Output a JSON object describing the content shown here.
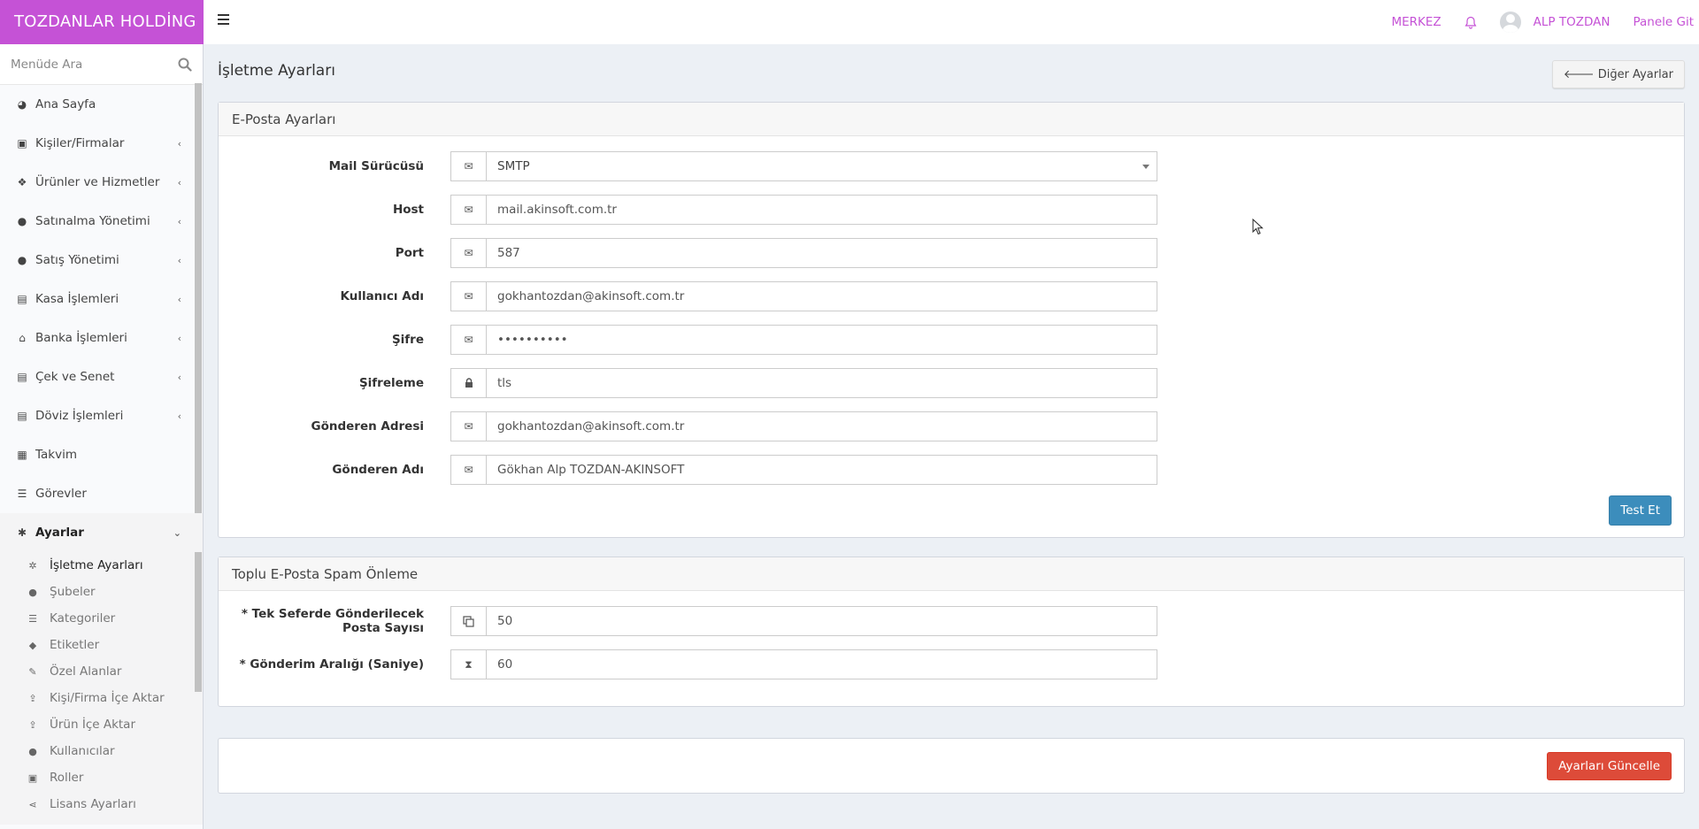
{
  "brand": "TOZDANLAR HOLDİNG",
  "topbar": {
    "branch": "MERKEZ",
    "user_name": "ALP TOZDAN",
    "panel_link": "Panele Git"
  },
  "sidebar": {
    "search_placeholder": "Menüde Ara",
    "items": [
      {
        "label": "Ana Sayfa",
        "icon": "dashboard-icon"
      },
      {
        "label": "Kişiler/Firmalar",
        "icon": "address-book-icon"
      },
      {
        "label": "Ürünler ve Hizmetler",
        "icon": "cubes-icon"
      },
      {
        "label": "Satınalma Yönetimi",
        "icon": "arrow-circle-down-icon"
      },
      {
        "label": "Satış Yönetimi",
        "icon": "arrow-circle-up-icon"
      },
      {
        "label": "Kasa İşlemleri",
        "icon": "money-icon"
      },
      {
        "label": "Banka İşlemleri",
        "icon": "bank-icon"
      },
      {
        "label": "Çek ve Senet",
        "icon": "money-icon"
      },
      {
        "label": "Döviz İşlemleri",
        "icon": "money-icon"
      },
      {
        "label": "Takvim",
        "icon": "calendar-icon"
      },
      {
        "label": "Görevler",
        "icon": "tasks-icon"
      },
      {
        "label": "Ayarlar",
        "icon": "gear-icon"
      }
    ],
    "settings_items": [
      {
        "label": "İşletme Ayarları",
        "icon": "gears-icon"
      },
      {
        "label": "Şubeler",
        "icon": "map-marker-icon"
      },
      {
        "label": "Kategoriler",
        "icon": "list-icon"
      },
      {
        "label": "Etiketler",
        "icon": "tag-icon"
      },
      {
        "label": "Özel Alanlar",
        "icon": "wrench-icon"
      },
      {
        "label": "Kişi/Firma İçe Aktar",
        "icon": "upload-icon"
      },
      {
        "label": "Ürün İçe Aktar",
        "icon": "upload-icon"
      },
      {
        "label": "Kullanıcılar",
        "icon": "user-icon"
      },
      {
        "label": "Roller",
        "icon": "briefcase-icon"
      },
      {
        "label": "Lisans Ayarları",
        "icon": "share-icon"
      }
    ]
  },
  "page": {
    "title": "İşletme Ayarları",
    "other_settings_button": "Diğer Ayarlar"
  },
  "email_settings": {
    "title": "E-Posta Ayarları",
    "fields": {
      "driver": {
        "label": "Mail Sürücüsü",
        "value": "SMTP"
      },
      "host": {
        "label": "Host",
        "value": "mail.akinsoft.com.tr"
      },
      "port": {
        "label": "Port",
        "value": "587"
      },
      "username": {
        "label": "Kullanıcı Adı",
        "value": "gokhantozdan@akinsoft.com.tr"
      },
      "password": {
        "label": "Şifre",
        "value": "••••••••••"
      },
      "encryption": {
        "label": "Şifreleme",
        "value": "tls"
      },
      "from_address": {
        "label": "Gönderen Adresi",
        "value": "gokhantozdan@akinsoft.com.tr"
      },
      "from_name": {
        "label": "Gönderen Adı",
        "value": "Gökhan Alp TOZDAN-AKINSOFT"
      }
    },
    "test_button": "Test Et"
  },
  "spam_settings": {
    "title": "Toplu E-Posta Spam Önleme",
    "fields": {
      "batch_count": {
        "label": "* Tek Seferde Gönderilecek Posta Sayısı",
        "value": "50"
      },
      "interval": {
        "label": "* Gönderim Aralığı (Saniye)",
        "value": "60"
      }
    }
  },
  "update_button": "Ayarları Güncelle",
  "colors": {
    "brand": "#c552d6",
    "primary": "#3c8dbc",
    "danger": "#dd4b39"
  }
}
